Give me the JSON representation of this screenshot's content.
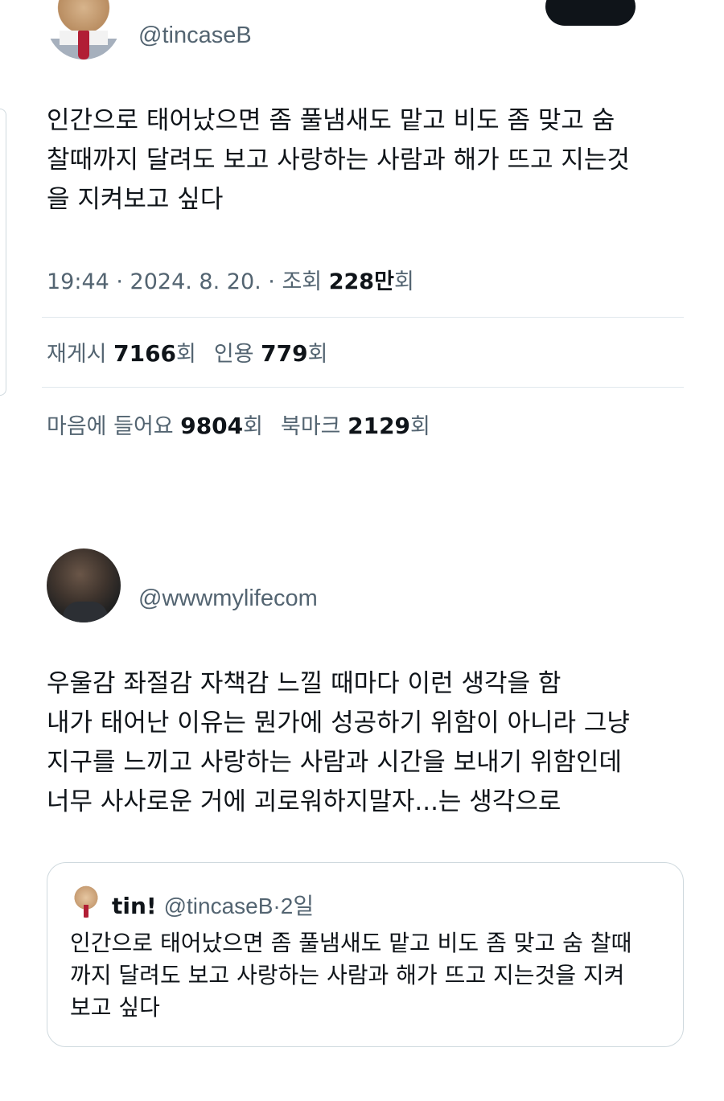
{
  "tweet1": {
    "handle": "@tincaseB",
    "text_lines": [
      "인간으로 태어났으면 좀 풀냄새도 맡고 비도 좀 맞고 숨",
      "찰때까지 달려도 보고 사랑하는 사람과 해가 뜨고 지는것",
      "을 지켜보고 싶다"
    ],
    "meta": {
      "time_date": "19:44 · 2024. 8. 20. · 조회 ",
      "views_num": "228만",
      "views_suffix": "회"
    },
    "stats": {
      "reposts_label": "재게시 ",
      "reposts_num": "7166",
      "reposts_suffix": "회",
      "quotes_label": "인용 ",
      "quotes_num": "779",
      "quotes_suffix": "회",
      "likes_label": "마음에 들어요 ",
      "likes_num": "9804",
      "likes_suffix": "회",
      "bookmarks_label": "북마크 ",
      "bookmarks_num": "2129",
      "bookmarks_suffix": "회"
    }
  },
  "tweet2": {
    "handle": "@wwwmylifecom",
    "text_lines": [
      "우울감 좌절감 자책감 느낄 때마다 이런 생각을 함",
      "내가 태어난 이유는 뭔가에 성공하기 위함이 아니라 그냥",
      "지구를 느끼고 사랑하는 사람과 시간을 보내기 위함인데",
      "너무 사사로운 거에 괴로워하지말자...는 생각으로"
    ],
    "quote": {
      "name": "tin!",
      "handle": "@tincaseB",
      "separator": "·",
      "time": "2일",
      "text_lines": [
        "인간으로 태어났으면 좀 풀냄새도 맡고 비도 좀 맞고 숨 찰때",
        "까지 달려도 보고 사랑하는 사람과 해가 뜨고 지는것을 지켜",
        "보고 싶다"
      ]
    }
  },
  "icons": {
    "avatar1": "dog-in-suit-avatar",
    "avatar2": "person-avatar",
    "quote_avatar": "dog-in-suit-avatar"
  },
  "colors": {
    "text_primary": "#0f1419",
    "text_secondary": "#536471",
    "divider": "#e1e8ed"
  }
}
